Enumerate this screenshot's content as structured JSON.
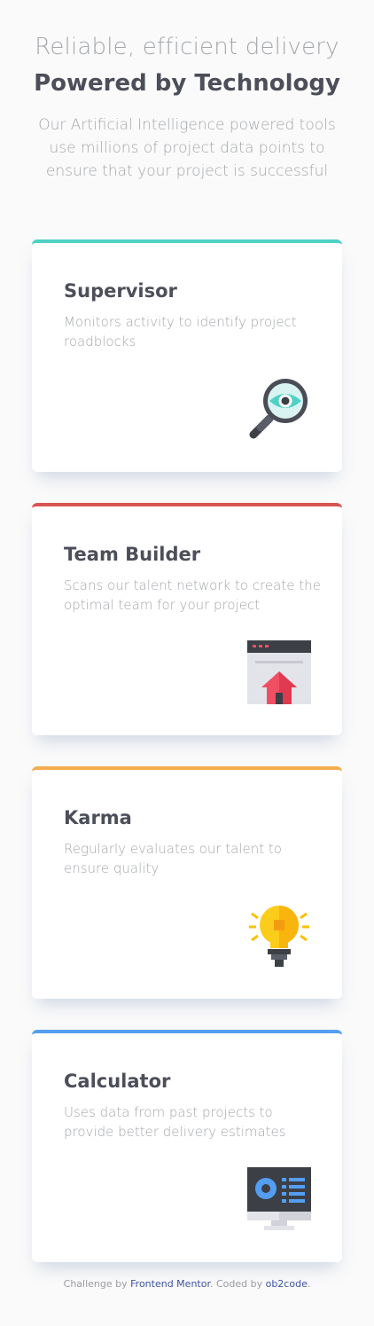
{
  "header": {
    "tagline": "Reliable, efficient delivery",
    "title": "Powered by Technology",
    "description": "Our Artificial Intelligence powered tools use millions of project data points to ensure that your project is successful"
  },
  "cards": [
    {
      "title": "Supervisor",
      "description": "Monitors activity to identify project roadblocks",
      "accent": "#4fd1c5",
      "icon": "magnifying-glass-eye-icon"
    },
    {
      "title": "Team Builder",
      "description": "Scans our talent network to create the optimal team for your project",
      "accent": "#d9534f",
      "icon": "browser-house-icon"
    },
    {
      "title": "Karma",
      "description": "Regularly evaluates our talent to ensure quality",
      "accent": "#f4ad4e",
      "icon": "lightbulb-icon"
    },
    {
      "title": "Calculator",
      "description": "Uses data from past projects to provide better delivery estimates",
      "accent": "#549ef2",
      "icon": "monitor-chart-icon"
    }
  ],
  "footer": {
    "prefix": "Challenge by ",
    "mentor_link": "Frontend Mentor",
    "middle": ". Coded by ",
    "author_link": "ob2code",
    "suffix": "."
  }
}
